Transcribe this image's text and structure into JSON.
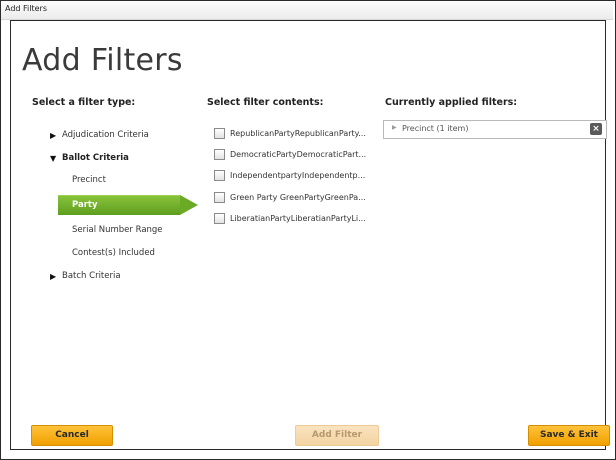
{
  "window": {
    "title": "Add Filters"
  },
  "page_title": "Add Filters",
  "columns": {
    "filter_type": "Select a filter type:",
    "filter_contents": "Select filter contents:",
    "applied": "Currently applied filters:"
  },
  "filter_types": {
    "adjudication": {
      "label": "Adjudication Criteria",
      "expanded": false
    },
    "ballot": {
      "label": "Ballot Criteria",
      "expanded": true,
      "children": [
        "Precinct",
        "Party",
        "Serial Number Range",
        "Contest(s) Included"
      ],
      "selected": "Party"
    },
    "batch": {
      "label": "Batch Criteria",
      "expanded": false
    }
  },
  "filter_contents": [
    {
      "label": "RepublicanPartyRepublicanParty...",
      "checked": false
    },
    {
      "label": "DemocraticPartyDemocraticPart...",
      "checked": false
    },
    {
      "label": "IndependentpartyIndependentp...",
      "checked": false
    },
    {
      "label": "Green Party GreenPartyGreenPa...",
      "checked": false
    },
    {
      "label": "LiberatianPartyLiberatianPartyLi...",
      "checked": false
    }
  ],
  "applied_filters": [
    {
      "label": "Precinct (1 item)"
    }
  ],
  "buttons": {
    "cancel": "Cancel",
    "add_filter": "Add Filter",
    "save_exit": "Save & Exit"
  },
  "colors": {
    "accent_orange": "#f7b31b",
    "selection_green": "#6aaa25",
    "add_filter_disabled": "#f3d4a2"
  }
}
